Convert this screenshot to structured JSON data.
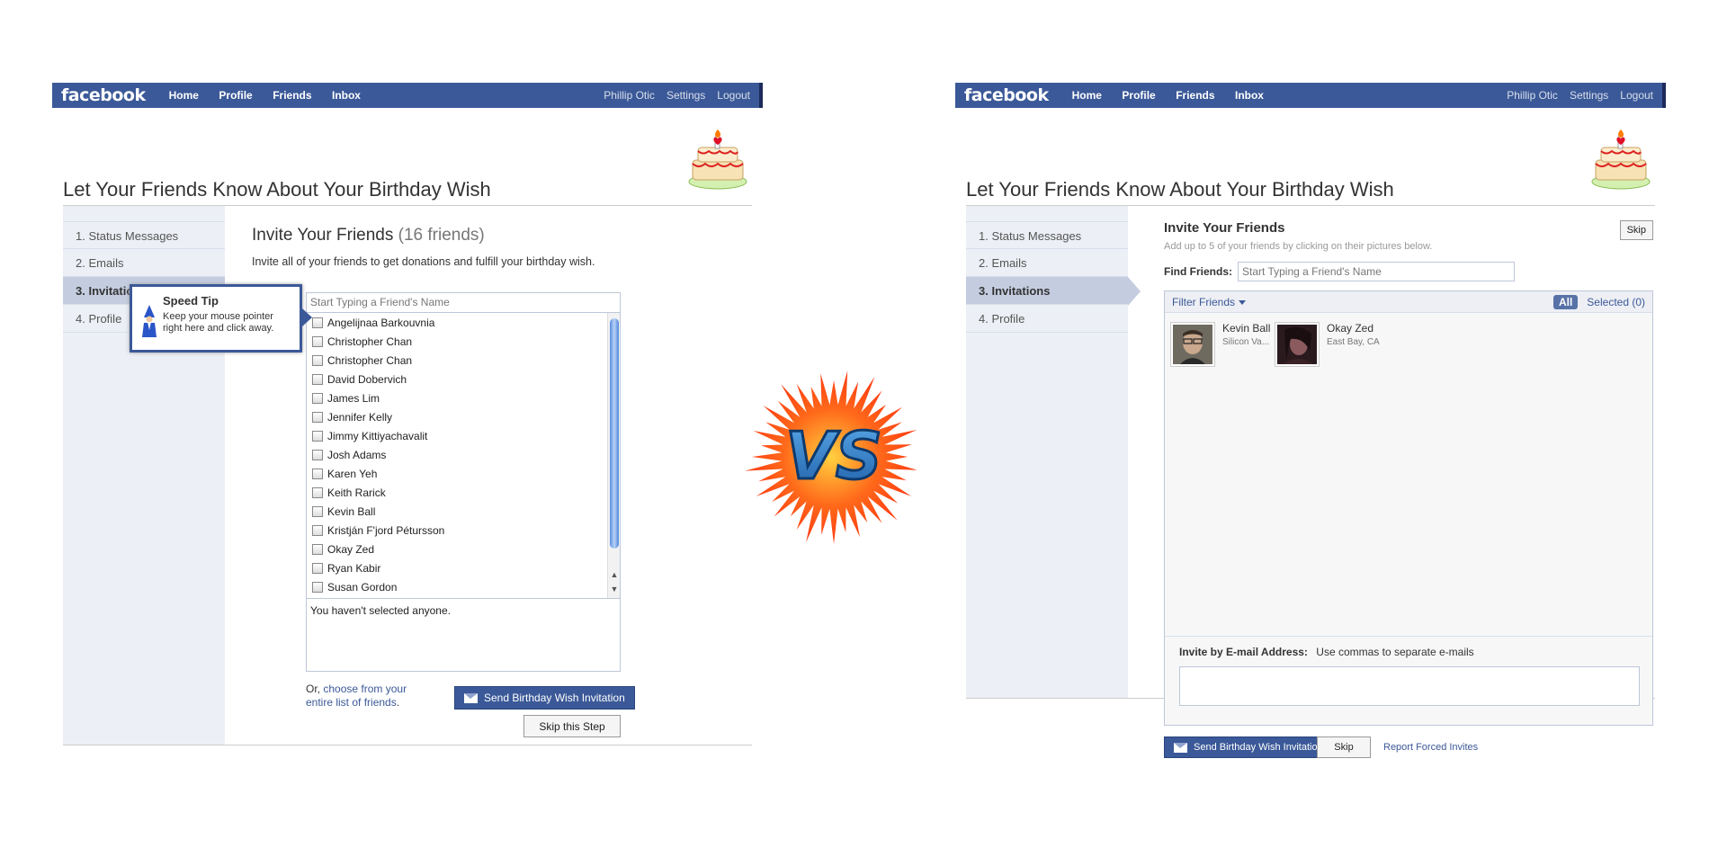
{
  "topbar": {
    "logo": "facebook",
    "nav": [
      "Home",
      "Profile",
      "Friends",
      "Inbox"
    ],
    "user": "Phillip Otic",
    "settings": "Settings",
    "logout": "Logout"
  },
  "page_title": "Let Your Friends Know About Your Birthday Wish",
  "sidebar": {
    "items": [
      "1. Status Messages",
      "2. Emails",
      "3. Invitations",
      "4. Profile"
    ],
    "active_index": 2
  },
  "left": {
    "invite_title": "Invite Your Friends",
    "friend_count": "(16 friends)",
    "subtitle": "Invite all of your friends to get donations and fulfill your birthday wish.",
    "search_placeholder": "Start Typing a Friend's Name",
    "friends": [
      "Angelijnaa Barkouvnia",
      "Christopher Chan",
      "Christopher Chan",
      "David Dobervich",
      "James Lim",
      "Jennifer Kelly",
      "Jimmy Kittiyachavalit",
      "Josh Adams",
      "Karen Yeh",
      "Keith Rarick",
      "Kevin Ball",
      "Kristján F'jord Pétursson",
      "Okay Zed",
      "Ryan Kabir",
      "Susan Gordon"
    ],
    "selected_text": "You haven't selected anyone.",
    "or_prefix": "Or,",
    "or_link": "choose from your entire list of friends",
    "or_suffix": ".",
    "send_label": "Send Birthday Wish Invitation",
    "skip_label": "Skip this Step",
    "speed_tip": {
      "title": "Speed Tip",
      "body": "Keep your mouse pointer right here and click away."
    }
  },
  "right": {
    "invite_title": "Invite Your Friends",
    "subtitle": "Add up to 5 of your friends by clicking on their pictures below.",
    "skip_top": "Skip",
    "find_label": "Find Friends:",
    "find_placeholder": "Start Typing a Friend's Name",
    "filter_label": "Filter Friends",
    "all_label": "All",
    "selected_label": "Selected (0)",
    "friends": [
      {
        "name": "Kevin Ball",
        "location": "Silicon Va..."
      },
      {
        "name": "Okay Zed",
        "location": "East Bay, CA"
      }
    ],
    "email_label": "Invite by E-mail Address:",
    "email_hint": "Use commas to separate e-mails",
    "send_label": "Send Birthday Wish Invitation",
    "skip_label": "Skip",
    "report_link": "Report Forced Invites"
  },
  "vs_text": "VS",
  "colors": {
    "fb_blue": "#3b5998",
    "sidebar_bg": "#eceff5",
    "active_item": "#c4cde0",
    "vs_orange": "#ff5a1e"
  }
}
